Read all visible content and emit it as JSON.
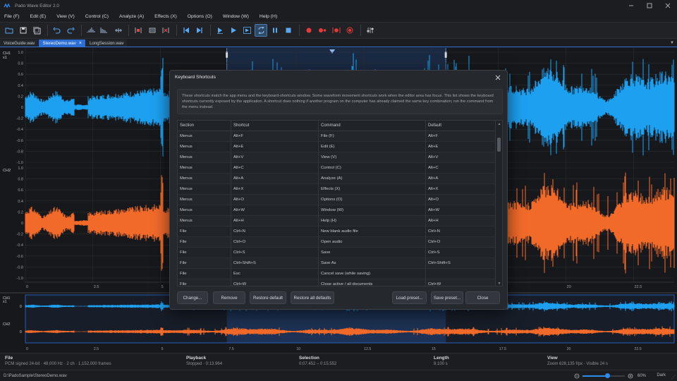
{
  "window": {
    "title": "Pado Wave Editor 2.0"
  },
  "menus": [
    "File (F)",
    "Edit (E)",
    "View (V)",
    "Control (C)",
    "Analyze (A)",
    "Effects (X)",
    "Options (O)",
    "Window (W)",
    "Help (H)"
  ],
  "tabs": [
    {
      "label": "VoiceGuide.wav",
      "active": false
    },
    {
      "label": "StereoDemo.wav",
      "active": true
    },
    {
      "label": "LongSession.wav",
      "active": false
    }
  ],
  "waveform": {
    "ch1_label": "CH1",
    "ch1_sub": "x1",
    "ch2_label": "CH2",
    "y_ticks": [
      "1.0",
      "0.8",
      "0.6",
      "0.4",
      "0.2",
      "0",
      "-0.2",
      "-0.4",
      "-0.6",
      "-0.8",
      "-1.0"
    ],
    "x_ticks": [
      "0",
      "2.5",
      "5",
      "7.5",
      "10",
      "12.5",
      "15",
      "17.5",
      "20",
      "22.5"
    ],
    "colors": {
      "ch1": "#1ea0f0",
      "ch2": "#f26a2a",
      "selection": "#2d6fd6"
    }
  },
  "overview": {
    "ch1_label": "CH1",
    "ch1_sub": "x1",
    "ch2_label": "CH2",
    "zero_label": "0"
  },
  "info": {
    "file": {
      "h": "File",
      "v": "PCM signed 24-bit · 48,000 Hz · 2 ch · 1,152,000 frames"
    },
    "playback": {
      "h": "Playback",
      "v": "Stopped · 0:13.964"
    },
    "selection": {
      "h": "Selection",
      "v": "0:07.452 – 0:15.552"
    },
    "length": {
      "h": "Length",
      "v": "8.100 s"
    },
    "view": {
      "h": "View",
      "v": "Zoom 628,135 f/px · Visible 24 s"
    }
  },
  "status": {
    "path": "D:\\PadoSample\\StereoDemo.wav",
    "zoom_percent": "60%",
    "zoom_value": 0.6,
    "theme": "Dark"
  },
  "dialog": {
    "title": "Keyboard Shortcuts",
    "description": "These shortcuts match the app menu and the keyboard-shortcuts window. Some waveform movement shortcuts work when the editor area has focus. This list shows the keyboard shortcuts currently exposed by the application. A shortcut does nothing if another program on the computer has already claimed the same key combination; run the command from the menu instead.",
    "columns": [
      "Section",
      "Shortcut",
      "Command",
      "Default"
    ],
    "rows": [
      [
        "Menus",
        "Alt+F",
        "File (F)",
        "Alt+F"
      ],
      [
        "Menus",
        "Alt+E",
        "Edit (E)",
        "Alt+E"
      ],
      [
        "Menus",
        "Alt+V",
        "View (V)",
        "Alt+V"
      ],
      [
        "Menus",
        "Alt+C",
        "Control (C)",
        "Alt+C"
      ],
      [
        "Menus",
        "Alt+A",
        "Analyze (A)",
        "Alt+A"
      ],
      [
        "Menus",
        "Alt+X",
        "Effects (X)",
        "Alt+X"
      ],
      [
        "Menus",
        "Alt+O",
        "Options (O)",
        "Alt+O"
      ],
      [
        "Menus",
        "Alt+W",
        "Window (W)",
        "Alt+W"
      ],
      [
        "Menus",
        "Alt+H",
        "Help (H)",
        "Alt+H"
      ],
      [
        "File",
        "Ctrl+N",
        "New blank audio file",
        "Ctrl+N"
      ],
      [
        "File",
        "Ctrl+O",
        "Open audio",
        "Ctrl+O"
      ],
      [
        "File",
        "Ctrl+S",
        "Save",
        "Ctrl+S"
      ],
      [
        "File",
        "Ctrl+Shift+S",
        "Save As",
        "Ctrl+Shift+S"
      ],
      [
        "File",
        "Esc",
        "Cancel save (while saving)",
        ""
      ],
      [
        "File",
        "Ctrl+W",
        "Close active / all documents",
        "Ctrl+W"
      ]
    ],
    "buttons": {
      "change": "Change...",
      "remove": "Remove",
      "restore_default": "Restore default",
      "restore_all": "Restore all defaults",
      "load_preset": "Load preset...",
      "save_preset": "Save preset...",
      "close": "Close"
    }
  },
  "toolbar_icons": [
    "open-folder-icon",
    "save-icon",
    "save-all-icon",
    "undo-icon",
    "redo-icon",
    "amplify-icon",
    "normalize-icon",
    "fade-icon",
    "trim-icon",
    "crop-icon",
    "delete-selection-icon",
    "go-start-icon",
    "go-end-icon",
    "play-from-cursor-icon",
    "play-icon",
    "play-selection-icon",
    "loop-icon",
    "pause-icon",
    "stop-icon",
    "record-icon",
    "record-append-icon",
    "record-punch-icon",
    "record-stop-icon",
    "mixer-icon"
  ]
}
